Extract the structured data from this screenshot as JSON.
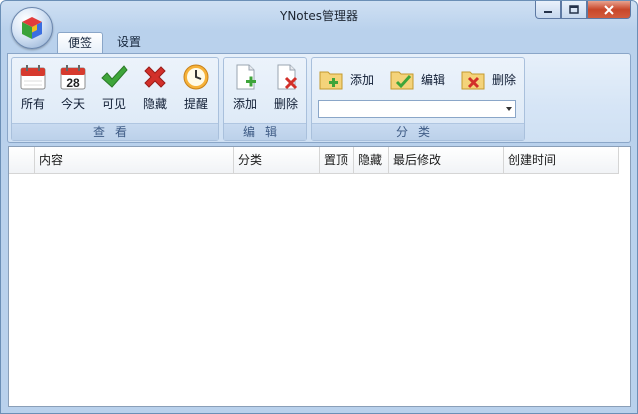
{
  "window": {
    "title": "YNotes管理器"
  },
  "tabs": [
    {
      "label": "便签"
    },
    {
      "label": "设置"
    }
  ],
  "groups": {
    "view": {
      "label": "查看",
      "buttons": [
        {
          "label": "所有",
          "icon": "calendar-icon"
        },
        {
          "label": "今天",
          "icon": "calendar-today-icon",
          "day": "28"
        },
        {
          "label": "可见",
          "icon": "checkmark-icon"
        },
        {
          "label": "隐藏",
          "icon": "red-x-icon"
        },
        {
          "label": "提醒",
          "icon": "clock-icon"
        }
      ]
    },
    "edit": {
      "label": "编辑",
      "buttons": [
        {
          "label": "添加",
          "icon": "add-note-icon"
        },
        {
          "label": "删除",
          "icon": "delete-note-icon"
        }
      ]
    },
    "category": {
      "label": "分类",
      "buttons": [
        {
          "label": "添加",
          "icon": "add-folder-icon"
        },
        {
          "label": "编辑",
          "icon": "edit-folder-icon"
        },
        {
          "label": "删除",
          "icon": "delete-folder-icon"
        }
      ],
      "dropdown_value": ""
    }
  },
  "table": {
    "columns": [
      "",
      "内容",
      "分类",
      "置顶",
      "隐藏",
      "最后修改",
      "创建时间"
    ],
    "rows": []
  },
  "colors": {
    "accent": "#3e5b85",
    "close": "#c8472a"
  }
}
